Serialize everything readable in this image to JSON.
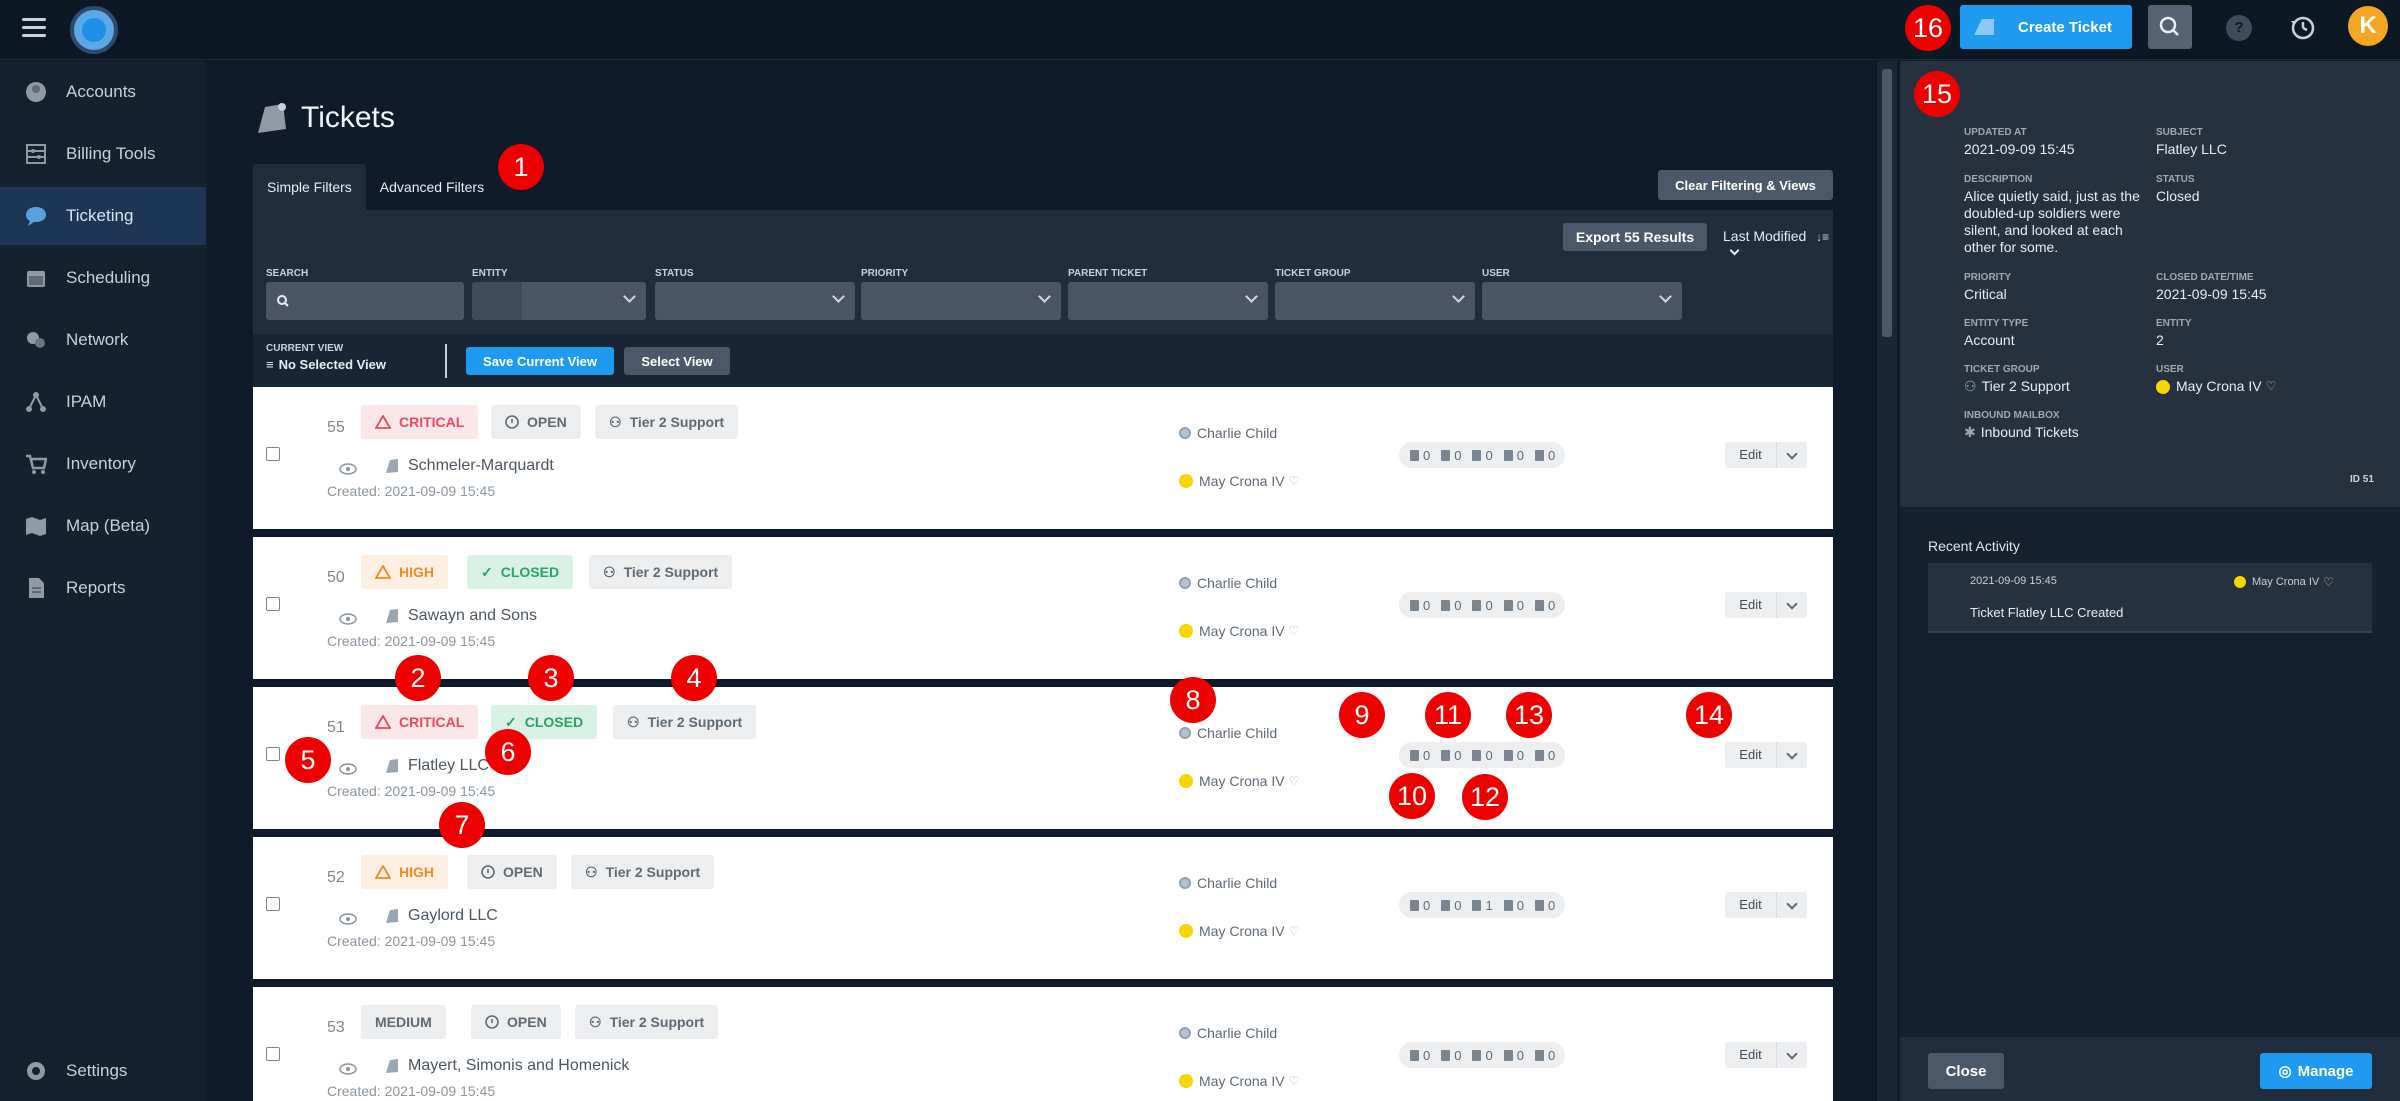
{
  "topbar": {
    "create_ticket": "Create Ticket",
    "help_icon": "?",
    "avatar_initial": "K"
  },
  "sidebar": {
    "items": [
      {
        "label": "Accounts",
        "icon": "account-icon"
      },
      {
        "label": "Billing Tools",
        "icon": "abacus-icon"
      },
      {
        "label": "Ticketing",
        "icon": "chat-icon",
        "active": true
      },
      {
        "label": "Scheduling",
        "icon": "calendar-icon"
      },
      {
        "label": "Network",
        "icon": "network-icon"
      },
      {
        "label": "IPAM",
        "icon": "ipam-icon"
      },
      {
        "label": "Inventory",
        "icon": "cart-icon"
      },
      {
        "label": "Map (Beta)",
        "icon": "map-icon"
      },
      {
        "label": "Reports",
        "icon": "report-icon"
      }
    ],
    "settings": "Settings"
  },
  "page": {
    "title": "Tickets",
    "tabs": {
      "simple": "Simple Filters",
      "advanced": "Advanced Filters"
    },
    "clear_btn": "Clear Filtering & Views",
    "export_btn": "Export 55 Results",
    "sort_label": "Last Modified",
    "filters": {
      "search": "SEARCH",
      "entity": "ENTITY",
      "status": "STATUS",
      "priority": "PRIORITY",
      "parent_ticket": "PARENT TICKET",
      "ticket_group": "TICKET GROUP",
      "user": "USER"
    },
    "view": {
      "label": "CURRENT VIEW",
      "value": "No Selected View",
      "save_btn": "Save Current View",
      "select_btn": "Select View"
    }
  },
  "tickets": [
    {
      "id": "55",
      "priority": "CRITICAL",
      "status": "OPEN",
      "group": "Tier 2 Support",
      "account": "Schmeler-Marquardt",
      "created": "Created: 2021-09-09 15:45",
      "assignee": "Charlie Child",
      "reporter": "May Crona IV",
      "counts": [
        "0",
        "0",
        "0",
        "0",
        "0"
      ],
      "edit": "Edit"
    },
    {
      "id": "50",
      "priority": "HIGH",
      "status": "CLOSED",
      "group": "Tier 2 Support",
      "account": "Sawayn and Sons",
      "created": "Created: 2021-09-09 15:45",
      "assignee": "Charlie Child",
      "reporter": "May Crona IV",
      "counts": [
        "0",
        "0",
        "0",
        "0",
        "0"
      ],
      "edit": "Edit"
    },
    {
      "id": "51",
      "priority": "CRITICAL",
      "status": "CLOSED",
      "group": "Tier 2 Support",
      "account": "Flatley LLC",
      "created": "Created: 2021-09-09 15:45",
      "assignee": "Charlie Child",
      "reporter": "May Crona IV",
      "counts": [
        "0",
        "0",
        "0",
        "0",
        "0"
      ],
      "edit": "Edit"
    },
    {
      "id": "52",
      "priority": "HIGH",
      "status": "OPEN",
      "group": "Tier 2 Support",
      "account": "Gaylord LLC",
      "created": "Created: 2021-09-09 15:45",
      "assignee": "Charlie Child",
      "reporter": "May Crona IV",
      "counts": [
        "0",
        "0",
        "1",
        "0",
        "0"
      ],
      "edit": "Edit"
    },
    {
      "id": "53",
      "priority": "MEDIUM",
      "status": "OPEN",
      "group": "Tier 2 Support",
      "account": "Mayert, Simonis and Homenick",
      "created": "Created: 2021-09-09 15:45",
      "assignee": "Charlie Child",
      "reporter": "May Crona IV",
      "counts": [
        "0",
        "0",
        "0",
        "0",
        "0"
      ],
      "edit": "Edit"
    }
  ],
  "detail": {
    "updated_at_label": "UPDATED AT",
    "updated_at": "2021-09-09 15:45",
    "subject_label": "SUBJECT",
    "subject": "Flatley LLC",
    "description_label": "DESCRIPTION",
    "description": "Alice quietly said, just as the doubled-up soldiers were silent, and looked at each other for some.",
    "status_label": "STATUS",
    "status": "Closed",
    "priority_label": "PRIORITY",
    "priority": "Critical",
    "closed_label": "CLOSED DATE/TIME",
    "closed": "2021-09-09 15:45",
    "entity_type_label": "ENTITY TYPE",
    "entity_type": "Account",
    "entity_label": "ENTITY",
    "entity": "2",
    "group_label": "TICKET GROUP",
    "group": "Tier 2 Support",
    "user_label": "USER",
    "user": "May Crona IV",
    "mailbox_label": "INBOUND MAILBOX",
    "mailbox": "Inbound Tickets",
    "id": "ID 51",
    "recent_title": "Recent Activity",
    "activity": {
      "time": "2021-09-09 15:45",
      "user": "May Crona IV",
      "text": "Ticket Flatley LLC Created"
    },
    "close_btn": "Close",
    "manage_btn": "Manage"
  },
  "annotations": [
    "1",
    "2",
    "3",
    "4",
    "5",
    "6",
    "7",
    "8",
    "9",
    "10",
    "11",
    "12",
    "13",
    "14",
    "15",
    "16"
  ]
}
